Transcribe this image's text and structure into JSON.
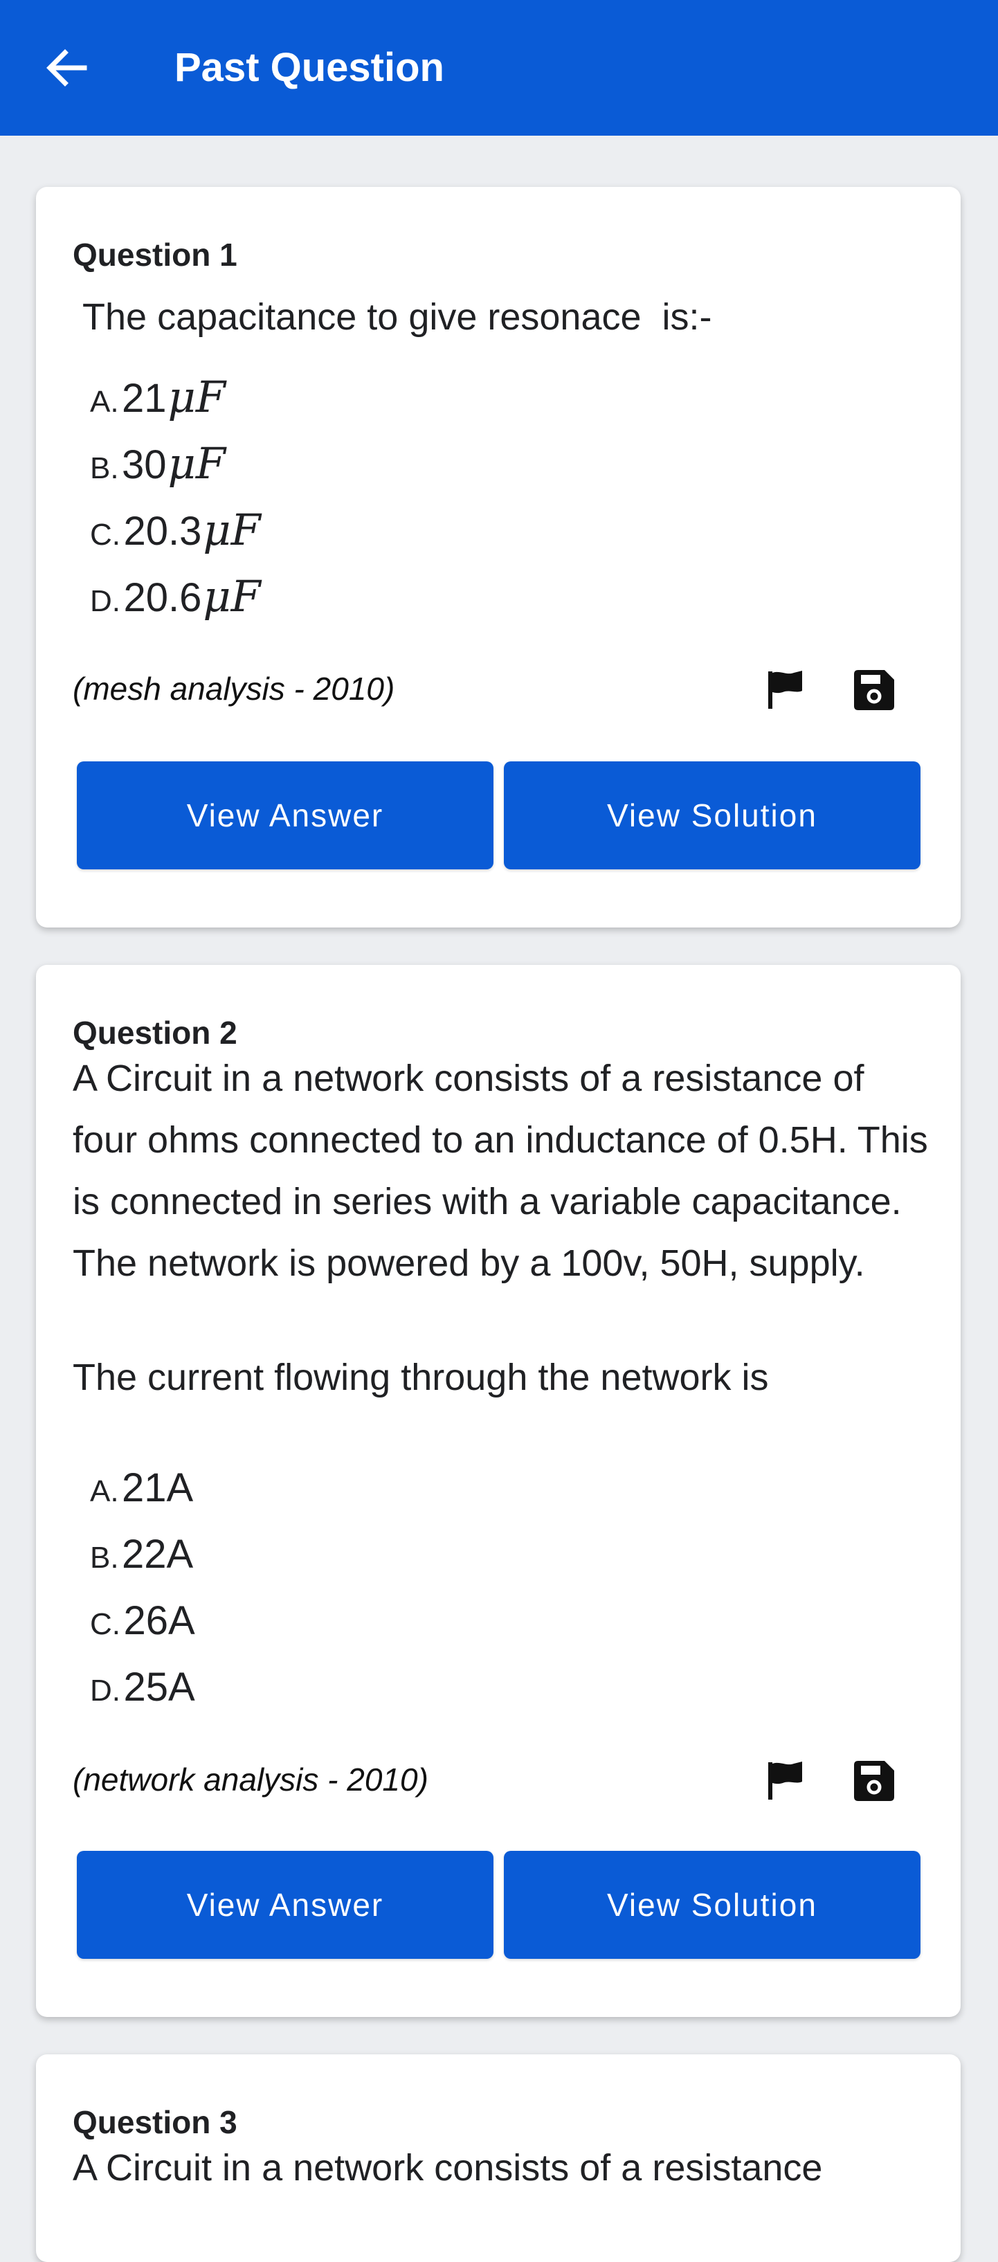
{
  "appbar": {
    "title": "Past Question",
    "back_icon": "arrow-left-icon"
  },
  "accent_color": "#0a5bd6",
  "questions": [
    {
      "number_label": "Question 1",
      "text": [
        " The capacitance to give resonace  is:-"
      ],
      "options": [
        {
          "letter": "A.",
          "value": "21",
          "unit": "μF"
        },
        {
          "letter": "B.",
          "value": "30",
          "unit": "μF"
        },
        {
          "letter": "C.",
          "value": "20.3",
          "unit": "μF"
        },
        {
          "letter": "D.",
          "value": "20.6",
          "unit": "μF"
        }
      ],
      "source": "(mesh analysis - 2010)",
      "view_answer_label": "View Answer",
      "view_solution_label": "View Solution"
    },
    {
      "number_label": "Question 2",
      "text": [
        "A Circuit in a network consists of a resistance of four ohms connected to an inductance of 0.5H. This is connected in series with a variable capacitance. The network is powered by a 100v, 50H, supply.",
        "The current flowing through the network is"
      ],
      "options": [
        {
          "letter": "A.",
          "value": "21A",
          "unit": ""
        },
        {
          "letter": "B.",
          "value": "22A",
          "unit": ""
        },
        {
          "letter": "C.",
          "value": "26A",
          "unit": ""
        },
        {
          "letter": "D.",
          "value": "25A",
          "unit": ""
        }
      ],
      "source": "(network analysis - 2010)",
      "view_answer_label": "View Answer",
      "view_solution_label": "View Solution"
    },
    {
      "number_label": "Question 3",
      "text": [
        "A Circuit in a network consists of a resistance"
      ]
    }
  ]
}
